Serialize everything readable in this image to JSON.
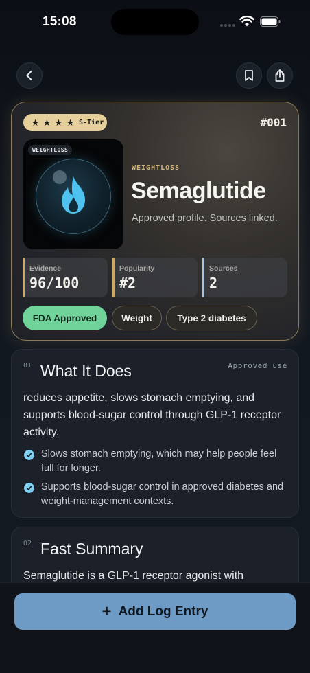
{
  "status_bar": {
    "time": "15:08"
  },
  "nav": {
    "back_icon": "chevron-left-icon",
    "bookmark_icon": "bookmark-icon",
    "share_icon": "share-icon"
  },
  "hero": {
    "tier_stars": 4,
    "tier_label": "S-Tier",
    "rank": "#001",
    "art_tag": "WEIGHTLOSS",
    "art_icon": "flame-icon",
    "category": "WEIGHTLOSS",
    "name": "Semaglutide",
    "description": "Approved profile. Sources linked.",
    "stats": [
      {
        "label": "Evidence",
        "value": "96/100",
        "color": "#c9a964"
      },
      {
        "label": "Popularity",
        "value": "#2",
        "color": "#c9a964"
      },
      {
        "label": "Sources",
        "value": "2",
        "color": "#9ec4e8"
      }
    ],
    "pills": [
      "FDA Approved",
      "Weight",
      "Type 2 diabetes"
    ],
    "accent": "#e5cf9b",
    "approved_color": "#6fd39a"
  },
  "sections": [
    {
      "number": "01",
      "title": "What It Does",
      "tag": "Approved use",
      "body": "reduces appetite, slows stomach emptying, and supports blood-sugar control through GLP-1 receptor activity.",
      "bullets": [
        "Slows stomach emptying, which may help people feel full for longer.",
        "Supports blood-sugar control in approved diabetes and weight-management contexts."
      ]
    },
    {
      "number": "02",
      "title": "Fast Summary",
      "body": "Semaglutide is a GLP-1 receptor agonist with"
    }
  ],
  "action": {
    "label": "Add Log Entry",
    "icon": "plus-icon",
    "color": "#6e9ac6"
  }
}
